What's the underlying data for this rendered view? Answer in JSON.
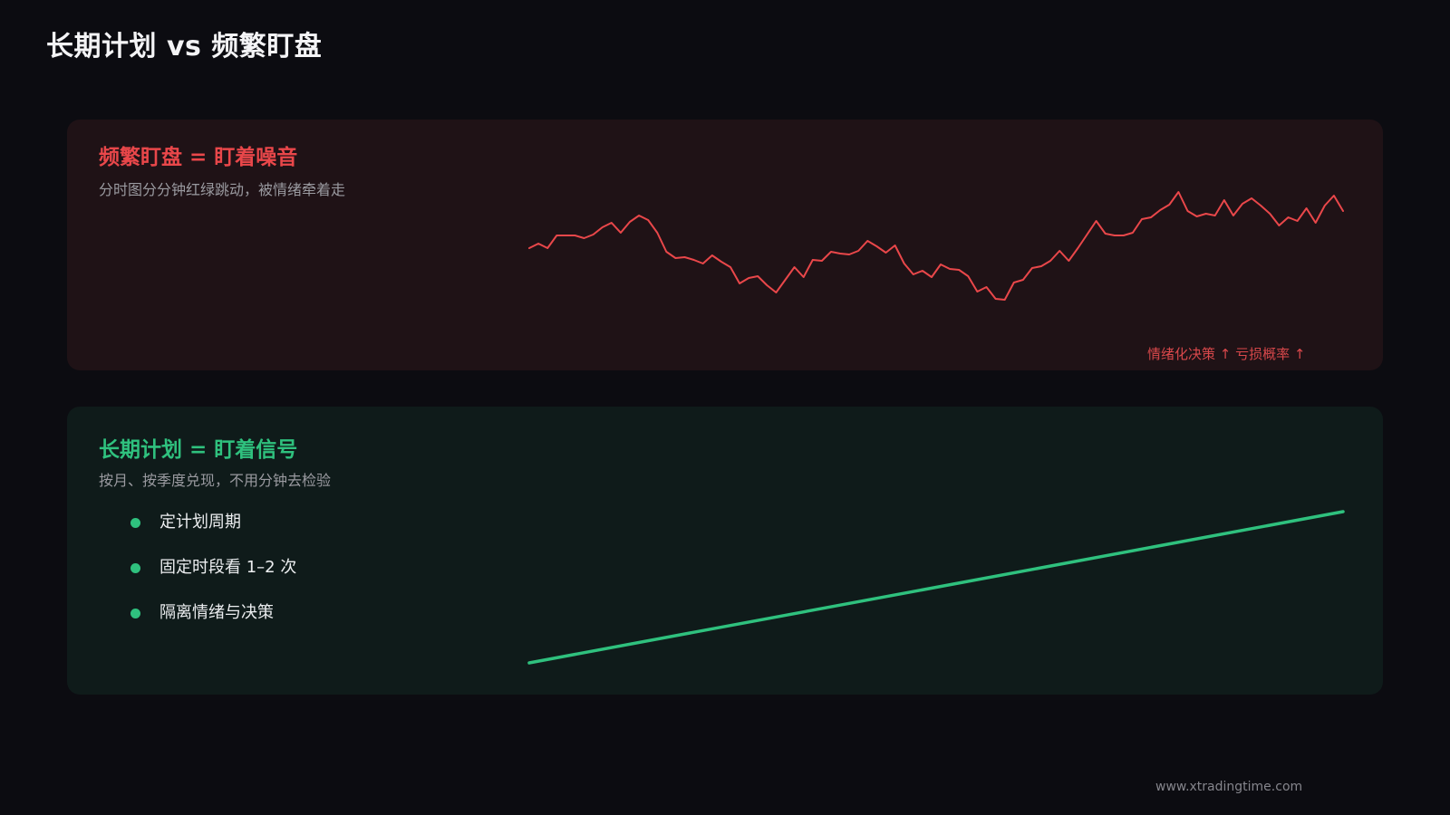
{
  "page": {
    "title": "长期计划 vs 频繁盯盘",
    "footer": "www.xtradingtime.com"
  },
  "noise_card": {
    "title": "频繁盯盘 = 盯着噪音",
    "subtitle": "分时图分分钟红绿跳动，被情绪牵着走",
    "caption": "情绪化决策 ↑ 亏损概率 ↑",
    "line_color": "#e9474a",
    "background": "#1f1216"
  },
  "signal_card": {
    "title": "长期计划 = 盯着信号",
    "subtitle": "按月、按季度兑现，不用分钟去检验",
    "bullets": [
      "定计划周期",
      "固定时段看 1–2 次",
      "隔离情绪与决策"
    ],
    "line_color": "#2fc17e",
    "background": "#0f1b1a"
  },
  "colors": {
    "page_background": "#0c0c11",
    "accent_red": "#e9474a",
    "accent_green": "#2fc17e"
  }
}
